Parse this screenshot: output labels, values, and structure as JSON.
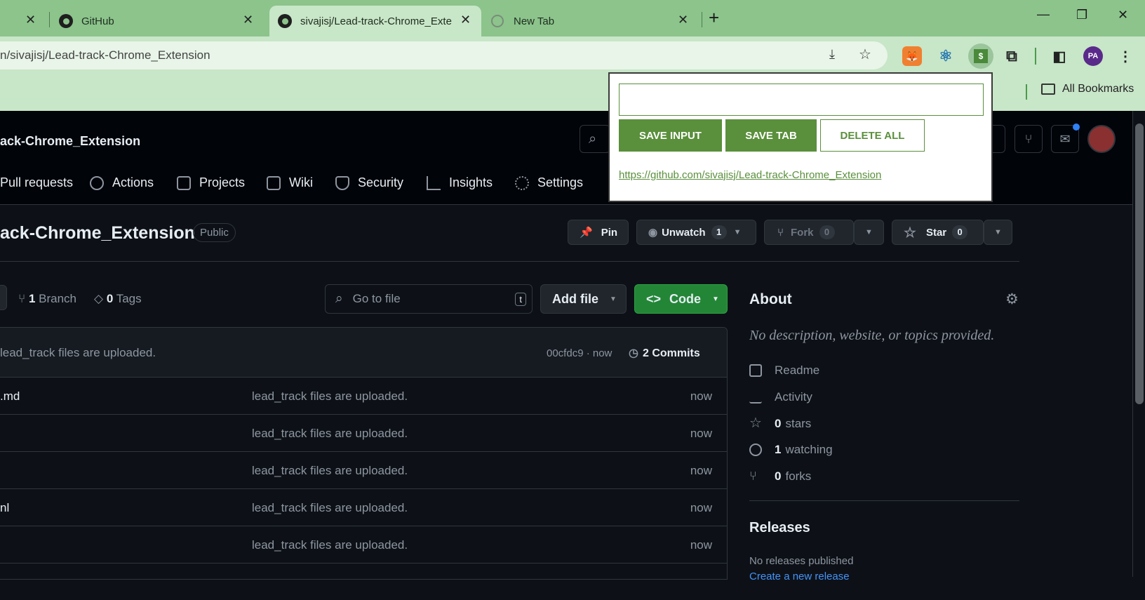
{
  "browser": {
    "tabs": [
      {
        "label": "GitHub"
      },
      {
        "label": "sivajisj/Lead-track-Chrome_Exte"
      },
      {
        "label": "New Tab"
      }
    ],
    "new_tab": "+",
    "close_glyph": "✕",
    "url": "n/sivajisj/Lead-track-Chrome_Extension",
    "bookmarks_folder": "All Bookmarks",
    "ext_price_glyph": "$",
    "accent": "#8cc48c"
  },
  "popup": {
    "input_value": "",
    "save_input": "SAVE INPUT",
    "save_tab": "SAVE TAB",
    "delete_all": "DELETE ALL",
    "saved_link": "https://github.com/sivajisj/Lead-track-Chrome_Extension",
    "accent": "#5a8f3c"
  },
  "github": {
    "repo_short": "ack-Chrome_Extension",
    "nav": [
      "Pull requests",
      "Actions",
      "Projects",
      "Wiki",
      "Security",
      "Insights",
      "Settings"
    ],
    "repo_title": "ack-Chrome_Extension",
    "visibility": "Public",
    "pin": "Pin",
    "unwatch": "Unwatch",
    "unwatch_count": "1",
    "fork": "Fork",
    "fork_count": "0",
    "star": "Star",
    "star_count": "0",
    "branch_count": "1",
    "branch_label": "Branch",
    "tag_count": "0",
    "tag_label": "Tags",
    "go_to_file": "Go to file",
    "shortcut_key": "t",
    "add_file": "Add file",
    "code": "Code",
    "commit_message": "lead_track files are uploaded.",
    "commit_hash": "00cfdc9 · now",
    "commits": "2 Commits",
    "files": [
      {
        "name": ".md",
        "message": "lead_track files are uploaded.",
        "time": "now"
      },
      {
        "name": "",
        "message": "lead_track files are uploaded.",
        "time": "now"
      },
      {
        "name": "",
        "message": "lead_track files are uploaded.",
        "time": "now"
      },
      {
        "name": "nl",
        "message": "lead_track files are uploaded.",
        "time": "now"
      },
      {
        "name": "",
        "message": "lead_track files are uploaded.",
        "time": "now"
      }
    ],
    "about": {
      "title": "About",
      "description": "No description, website, or topics provided.",
      "readme": "Readme",
      "activity": "Activity",
      "stars_count": "0",
      "stars_label": "stars",
      "watching_count": "1",
      "watching_label": "watching",
      "forks_count": "0",
      "forks_label": "forks"
    },
    "releases": {
      "title": "Releases",
      "none": "No releases published",
      "create": "Create a new release"
    }
  }
}
